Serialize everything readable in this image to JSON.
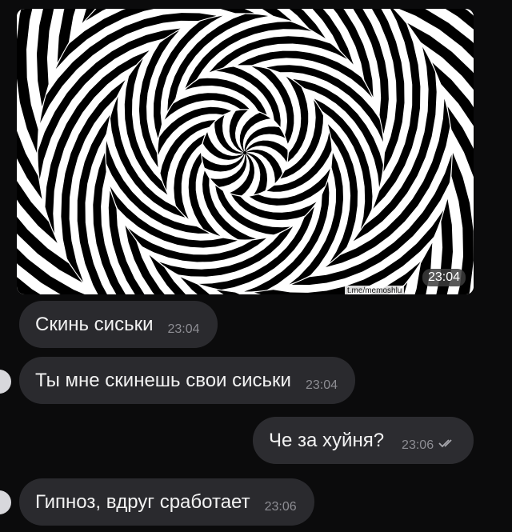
{
  "image_message": {
    "watermark": "t.me/memoshlu",
    "time": "23:04"
  },
  "messages": [
    {
      "text": "Скинь сиськи",
      "time": "23:04",
      "direction": "in"
    },
    {
      "text": "Ты мне скинешь свои сиськи",
      "time": "23:04",
      "direction": "in"
    },
    {
      "text": "Че за хуйня?",
      "time": "23:06",
      "direction": "out",
      "status": "read"
    },
    {
      "text": "Гипноз, вдруг сработает",
      "time": "23:06",
      "direction": "in"
    }
  ]
}
